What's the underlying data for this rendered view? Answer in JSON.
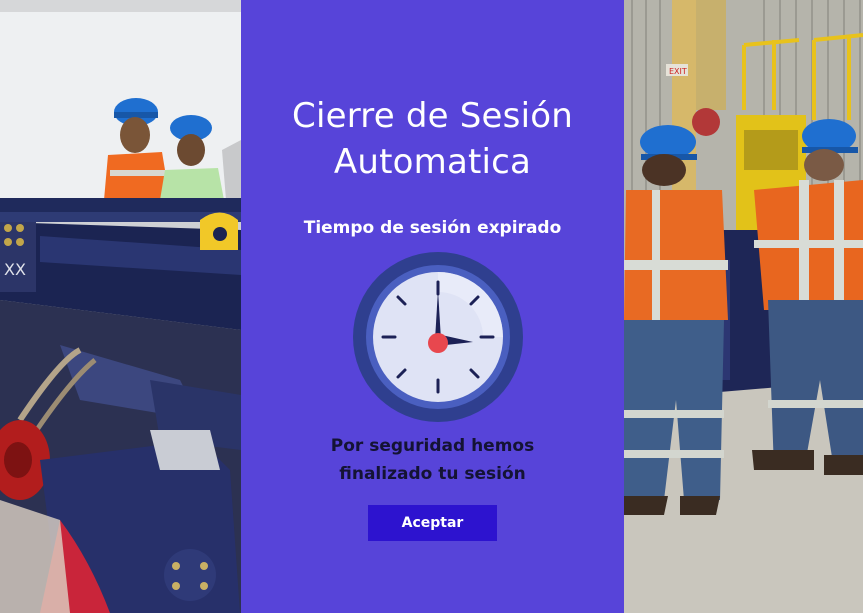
{
  "modal": {
    "title_line1": "Cierre de Sesión",
    "title_line2": "Automatica",
    "subtitle": "Tiempo de sesión expirado",
    "message_line1": "Por seguridad hemos",
    "message_line2": "finalizado tu sesión",
    "accept_label": "Aceptar",
    "icon": "clock-icon"
  },
  "colors": {
    "panel_bg": "#5744d9",
    "button_bg": "#2d13cf",
    "message_text": "#141334",
    "clock_face": "#dfe3f5",
    "clock_rim": "#2f3f8f",
    "clock_hand_center": "#e8474e"
  }
}
